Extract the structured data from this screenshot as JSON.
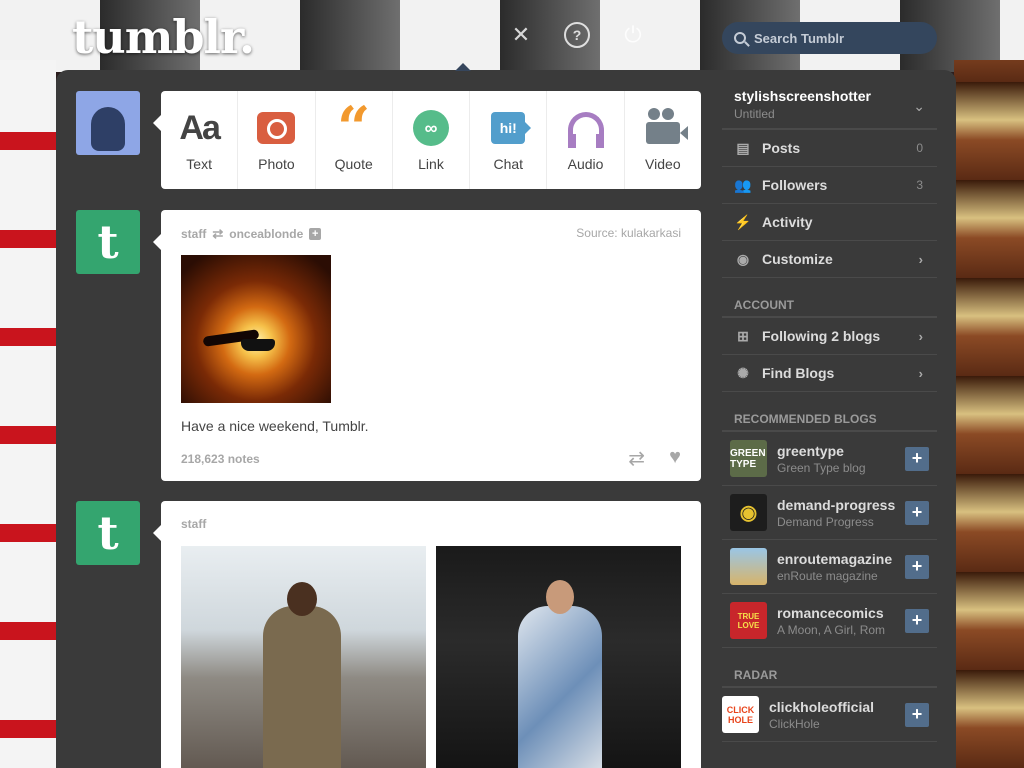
{
  "header": {
    "logo": "tumblr.",
    "search_placeholder": "Search Tumblr",
    "icons": [
      "close-icon",
      "help-icon",
      "power-icon"
    ]
  },
  "composer": {
    "types": [
      {
        "label": "Text",
        "icon": "text-icon",
        "glyph": "Aa",
        "color": "#444444"
      },
      {
        "label": "Photo",
        "icon": "camera-icon",
        "glyph": "",
        "color": "#d95e40"
      },
      {
        "label": "Quote",
        "icon": "quote-icon",
        "glyph": "66",
        "color": "#f2992e"
      },
      {
        "label": "Link",
        "icon": "link-icon",
        "glyph": "∞",
        "color": "#56bc8a"
      },
      {
        "label": "Chat",
        "icon": "chat-icon",
        "glyph": "hi!",
        "color": "#529ecc"
      },
      {
        "label": "Audio",
        "icon": "headphones-icon",
        "glyph": "",
        "color": "#a77dc2"
      },
      {
        "label": "Video",
        "icon": "video-camera-icon",
        "glyph": "",
        "color": "#748089"
      }
    ]
  },
  "posts": [
    {
      "author": "staff",
      "reblogged_from": "onceablonde",
      "source_label": "Source:",
      "source": "kulakarkasi",
      "caption": "Have a nice weekend, Tumblr.",
      "notes": "218,623 notes"
    },
    {
      "author": "staff"
    }
  ],
  "sidebar": {
    "blog_name": "stylishscreenshotter",
    "blog_title": "Untitled",
    "nav": [
      {
        "label": "Posts",
        "count": "0",
        "icon": "document-icon"
      },
      {
        "label": "Followers",
        "count": "3",
        "icon": "people-icon"
      },
      {
        "label": "Activity",
        "count": "",
        "icon": "lightning-icon"
      },
      {
        "label": "Customize",
        "count": "",
        "icon": "eye-icon"
      }
    ],
    "account_title": "ACCOUNT",
    "account": [
      {
        "label": "Following 2 blogs",
        "icon": "add-person-icon"
      },
      {
        "label": "Find Blogs",
        "icon": "compass-icon"
      }
    ],
    "recommended_title": "RECOMMENDED BLOGS",
    "recommended": [
      {
        "name": "greentype",
        "title": "Green Type blog",
        "thumb_text": "GREEN TYPE",
        "thumb_color": "#5c6b48"
      },
      {
        "name": "demand-progress",
        "title": "Demand Progress",
        "thumb_text": "◉",
        "thumb_color": "#1d1d1d"
      },
      {
        "name": "enroutemagazine",
        "title": "enRoute magazine",
        "thumb_text": "",
        "thumb_color": "#d7b46a"
      },
      {
        "name": "romancecomics",
        "title": "A Moon, A Girl, Rom",
        "thumb_text": "TRUE LOVE",
        "thumb_color": "#c8262b"
      }
    ],
    "radar_title": "RADAR",
    "radar": {
      "name": "clickholeofficial",
      "title": "ClickHole",
      "thumb_text": "CLICK HOLE",
      "thumb_color": "#ffffff"
    }
  }
}
